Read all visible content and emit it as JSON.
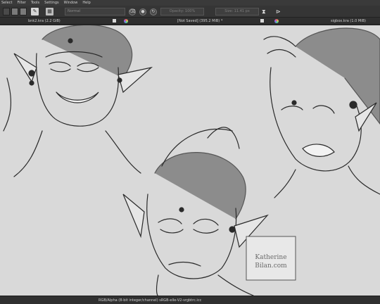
{
  "menu": {
    "items": [
      "Select",
      "Filter",
      "Tools",
      "Settings",
      "Window",
      "Help"
    ]
  },
  "toolbar": {
    "blend_mode": "Normal",
    "opacity": "Opacity: 100%",
    "size": "Size: 11.41 px"
  },
  "tabs": [
    {
      "label": "bnk2.kra (2.2 GiB)"
    },
    {
      "label": "[Not Saved]  (395.2 MiB) *"
    },
    {
      "label": "sigbox.kra (1.0 MiB)"
    }
  ],
  "canvas": {
    "signature": [
      "Katherine",
      "Bilan.com"
    ]
  },
  "status": {
    "text": "RGB/Alpha (8-bit integer/channel)  sRGB-elle-V2-srgbtrc.icc"
  },
  "colors": {
    "canvas_bg": "#d9d9d9",
    "chrome_bg": "#353535",
    "sketch_stroke": "#2a2a2a",
    "hair_shadow": "#8c8c8c"
  },
  "icons": [
    "eraser-icon",
    "alpha-lock-icon",
    "reload-icon",
    "mirror-icon",
    "wrap-icon"
  ]
}
